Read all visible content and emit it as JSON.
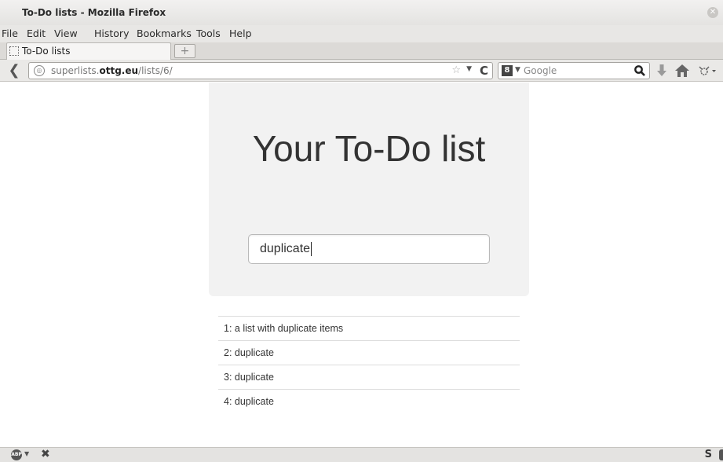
{
  "window": {
    "title": "To-Do lists - Mozilla Firefox"
  },
  "menubar": {
    "items": [
      "File",
      "Edit",
      "View",
      "History",
      "Bookmarks",
      "Tools",
      "Help"
    ]
  },
  "tabs": [
    {
      "label": "To-Do lists"
    }
  ],
  "navbar": {
    "url_prefix": "superlists.",
    "url_domain": "ottg.eu",
    "url_path": "/lists/6/",
    "search_placeholder": "Google",
    "search_engine_letter": "8"
  },
  "page": {
    "heading": "Your To-Do list",
    "input_value": "duplicate",
    "items": [
      "1: a list with duplicate items",
      "2: duplicate",
      "3: duplicate",
      "4: duplicate"
    ]
  },
  "statusbar": {
    "abp_label": "ABP",
    "right_icon": "S"
  },
  "colors": {
    "jumbotron_bg": "#f2f2f2",
    "chrome_bg": "#e8e7e5"
  }
}
